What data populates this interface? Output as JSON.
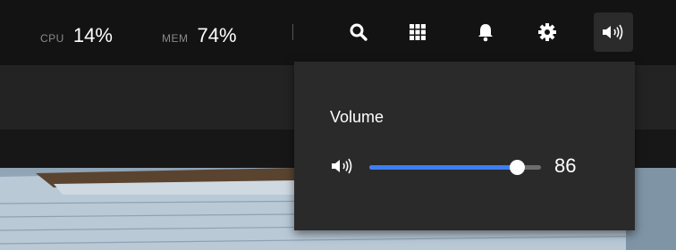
{
  "stats": {
    "cpu_label": "CPU",
    "cpu_value": "14%",
    "mem_label": "MEM",
    "mem_value": "74%"
  },
  "toolbar": {
    "icons": [
      "search-icon",
      "apps-grid-icon",
      "bell-icon",
      "gear-icon",
      "speaker-icon"
    ]
  },
  "volume_popup": {
    "title": "Volume",
    "value": 86,
    "value_text": "86",
    "accent": "#3d7ff2"
  }
}
